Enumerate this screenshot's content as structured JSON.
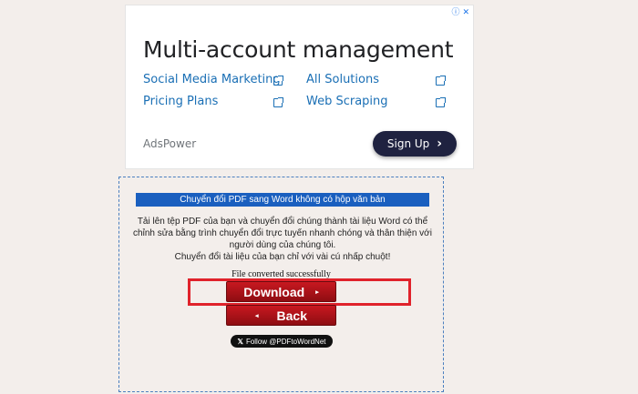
{
  "ad": {
    "title": "Multi-account management",
    "links": [
      {
        "label": "Social Media Marketing"
      },
      {
        "label": "All Solutions"
      },
      {
        "label": "Pricing Plans"
      },
      {
        "label": "Web Scraping"
      }
    ],
    "brand": "AdsPower",
    "signup_label": "Sign Up",
    "info_icon": "ⓘ",
    "close_icon": "✕"
  },
  "tool": {
    "header": "Chuyển đổi PDF sang Word không có hộp văn bản",
    "description_line1": "Tải lên tệp PDF của bạn và chuyển đổi chúng thành tài liệu Word có thể chỉnh sửa bằng trình chuyển đổi trực tuyến nhanh chóng và thân thiện với người dùng của chúng tôi.",
    "description_line2": "Chuyển đổi tài liệu của bạn chỉ với vài cú nhấp chuột!",
    "status": "File converted successfully",
    "download_label": "Download",
    "back_label": "Back",
    "follow_label": "Follow @PDFtoWordNet"
  },
  "colors": {
    "header_bg": "#1a5fbf",
    "button_red": "#c81820",
    "highlight_red": "#e0222b",
    "signup_bg": "#1f2240"
  }
}
